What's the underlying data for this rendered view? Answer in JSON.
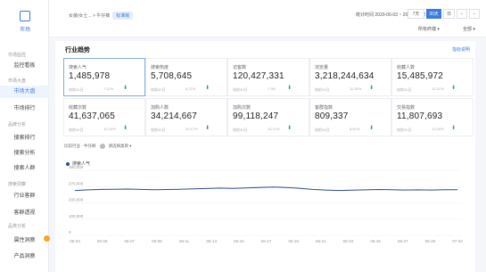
{
  "sidebar": {
    "logo_label": "市场",
    "groups": [
      {
        "label": "市场监控",
        "top": 58
      },
      {
        "label": "市场大盘",
        "top": 87
      },
      {
        "label": "品牌分析",
        "top": 136
      },
      {
        "label": "搜索洞察",
        "top": 203
      },
      {
        "label": "品类分析",
        "top": 250
      }
    ],
    "items": [
      {
        "label": "监控看板",
        "top": 67,
        "active": false
      },
      {
        "label": "市场大盘",
        "top": 96,
        "active": true
      },
      {
        "label": "市场排行",
        "top": 115,
        "active": false
      },
      {
        "label": "搜索排行",
        "top": 148,
        "active": false
      },
      {
        "label": "搜索分析",
        "top": 165,
        "active": false
      },
      {
        "label": "搜索人群",
        "top": 182,
        "active": false
      },
      {
        "label": "行业客群",
        "top": 213,
        "active": false
      },
      {
        "label": "客群透视",
        "top": 232,
        "active": false
      },
      {
        "label": "属性洞察",
        "top": 263,
        "active": false
      },
      {
        "label": "产品洞察",
        "top": 281,
        "active": false
      }
    ]
  },
  "topbar": {
    "breadcrumb": "女装/女士... > 牛仔裤",
    "tag": "标准版",
    "daterange": "统计时间 2020-06-03 ~ 2020-07-02",
    "segments": [
      {
        "label": "7天",
        "on": false
      },
      {
        "label": "30天",
        "on": true
      },
      {
        "label": "日",
        "on": false
      },
      {
        "label": "‹",
        "on": false
      },
      {
        "label": "›",
        "on": false
      }
    ],
    "filter1": "所有终端 ▾",
    "filter2": "全部 ▾"
  },
  "panel": {
    "title": "行业趋势",
    "link": "指标说明",
    "metrics": [
      {
        "label": "搜索人气",
        "value": "1,485,978",
        "compare": "较前30日",
        "pct": "7.12%",
        "selected": true
      },
      {
        "label": "搜索热度",
        "value": "5,708,645",
        "compare": "较前30日",
        "pct": "6.27%",
        "selected": false
      },
      {
        "label": "访客数",
        "value": "120,427,331",
        "compare": "较前30日",
        "pct": "7.3%",
        "selected": false
      },
      {
        "label": "浏览量",
        "value": "3,218,244,634",
        "compare": "较前30日",
        "pct": "11.35%",
        "selected": false
      },
      {
        "label": "收藏人数",
        "value": "15,485,972",
        "compare": "较前30日",
        "pct": "12.37%",
        "selected": false
      },
      {
        "label": "收藏次数",
        "value": "41,637,065",
        "compare": "较前30日",
        "pct": "12.19%",
        "selected": false
      },
      {
        "label": "加购人数",
        "value": "34,214,667",
        "compare": "较前30日",
        "pct": "10.17%",
        "selected": false
      },
      {
        "label": "加购次数",
        "value": "99,118,247",
        "compare": "较前30日",
        "pct": "13.71%",
        "selected": false
      },
      {
        "label": "客群指数",
        "value": "809,337",
        "compare": "较前30日",
        "pct": "8.61%",
        "selected": false
      },
      {
        "label": "交易指数",
        "value": "11,807,693",
        "compare": "较前30日",
        "pct": "13.49%",
        "selected": false
      }
    ],
    "control_text": "比较行业 · 牛仔裤",
    "control_select": "请选择类目 ▾",
    "arrow_glyph": "⬇"
  },
  "chart_data": {
    "type": "line",
    "title": "",
    "xlabel": "",
    "ylabel": "",
    "ylim": [
      0,
      400000
    ],
    "yticks": [
      0,
      100000,
      200000,
      300000,
      400000
    ],
    "ytick_labels": [
      "0",
      "100,000",
      "200,000",
      "270,000",
      "360,000"
    ],
    "categories": [
      "06-03",
      "06-05",
      "06-07",
      "06-09",
      "06-11",
      "06-13",
      "06-15",
      "06-17",
      "06-19",
      "06-21",
      "06-23",
      "06-25",
      "06-27",
      "06-29",
      "07-02"
    ],
    "grid": true,
    "legend": "top-left",
    "series": [
      {
        "name": "搜索人气",
        "color": "#2b4b8c",
        "x": [
          "06-03",
          "06-04",
          "06-05",
          "06-06",
          "06-07",
          "06-08",
          "06-09",
          "06-10",
          "06-11",
          "06-12",
          "06-13",
          "06-14",
          "06-15",
          "06-16",
          "06-17",
          "06-18",
          "06-19",
          "06-20",
          "06-21",
          "06-22",
          "06-23",
          "06-24",
          "06-25",
          "06-26",
          "06-27",
          "06-28",
          "06-29",
          "06-30",
          "07-01",
          "07-02"
        ],
        "values": [
          276000,
          280000,
          283000,
          284000,
          285000,
          283000,
          281000,
          282000,
          284000,
          286000,
          288000,
          291000,
          289000,
          292000,
          294000,
          297000,
          295000,
          290000,
          283000,
          279000,
          276000,
          278000,
          280000,
          282000,
          281000,
          279000,
          280000,
          279000,
          281000,
          281000
        ]
      }
    ]
  }
}
